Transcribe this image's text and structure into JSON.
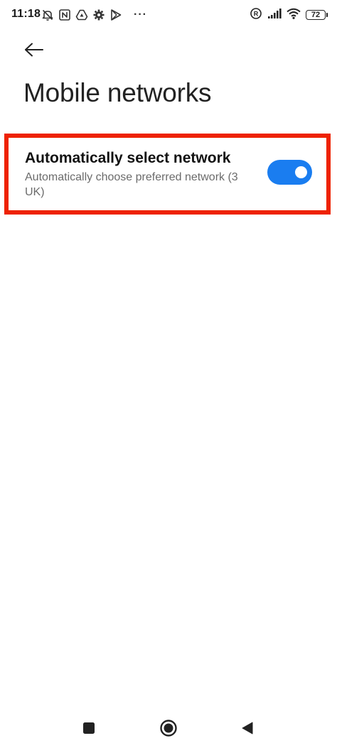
{
  "status_bar": {
    "time": "11:18",
    "more_indicator": "···",
    "battery_level": "72",
    "left_icons": [
      "muted-alarm-icon",
      "nfc-icon",
      "drive-icon",
      "settings-gear-icon",
      "play-store-icon"
    ],
    "right_icons": [
      "registered-icon",
      "signal-icon",
      "wifi-icon",
      "battery-icon"
    ]
  },
  "header": {
    "back_icon": "arrow-left-icon",
    "title": "Mobile networks"
  },
  "settings": {
    "auto_select": {
      "title": "Automatically select network",
      "subtitle": "Automatically choose preferred network (3 UK)",
      "enabled": true
    }
  },
  "colors": {
    "accent": "#1a7df0",
    "highlight": "#ee2200",
    "background": "#ffffff",
    "text_primary": "#111111",
    "text_secondary": "#6b6b6b"
  },
  "nav_bar": {
    "icons": [
      "recents-square-icon",
      "home-circle-icon",
      "back-triangle-icon"
    ]
  }
}
